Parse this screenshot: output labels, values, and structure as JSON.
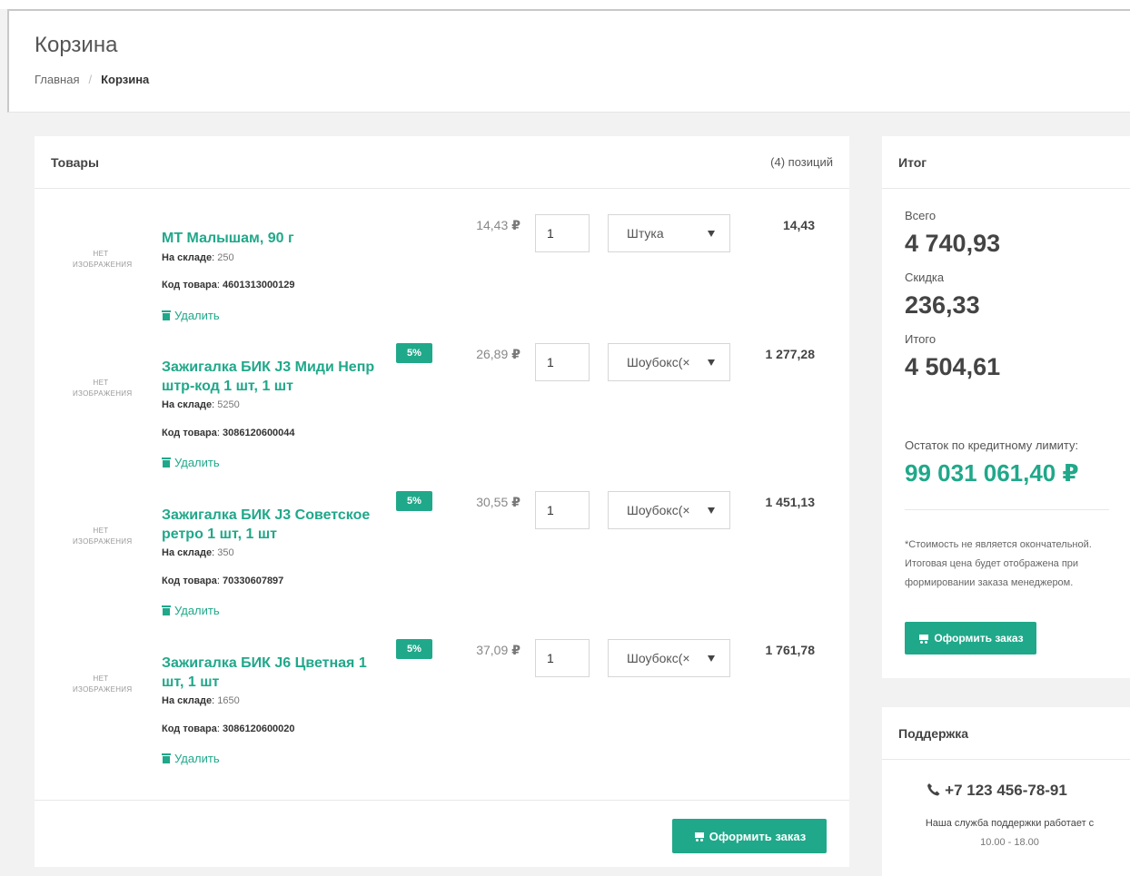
{
  "page": {
    "title": "Корзина"
  },
  "breadcrumb": {
    "home": "Главная",
    "separator": "/",
    "current": "Корзина"
  },
  "cart": {
    "header": "Товары",
    "count_label": "(4) позиций",
    "no_image": [
      "НЕТ",
      "ИЗОБРАЖЕНИЯ"
    ],
    "stock_label": "На складе",
    "code_label": "Код товара",
    "delete_label": "Удалить",
    "currency": "₽",
    "items": [
      {
        "name": "МТ Малышам, 90 г",
        "stock": "250",
        "code": "4601313000129",
        "discount": "",
        "price": "14,43",
        "qty": "1",
        "unit": "Штука",
        "total": "14,43"
      },
      {
        "name": "Зажигалка БИК J3 Миди Непр штр-код 1 шт, 1 шт",
        "stock": "5250",
        "code": "3086120600044",
        "discount": "5%",
        "price": "26,89",
        "qty": "1",
        "unit": "Шоубокс(×",
        "total": "1 277,28"
      },
      {
        "name": "Зажигалка БИК J3 Советское ретро 1 шт, 1 шт",
        "stock": "350",
        "code": "70330607897",
        "discount": "5%",
        "price": "30,55",
        "qty": "1",
        "unit": "Шоубокс(×",
        "total": "1 451,13"
      },
      {
        "name": "Зажигалка БИК J6 Цветная 1 шт, 1 шт",
        "stock": "1650",
        "code": "3086120600020",
        "discount": "5%",
        "price": "37,09",
        "qty": "1",
        "unit": "Шоубокс(×",
        "total": "1 761,78"
      }
    ],
    "checkout_label": "Оформить заказ"
  },
  "summary": {
    "header": "Итог",
    "total_label": "Всего",
    "total_value": "4 740,93",
    "discount_label": "Скидка",
    "discount_value": "236,33",
    "final_label": "Итого",
    "final_value": "4 504,61",
    "credit_label": "Остаток по кредитному лимиту:",
    "credit_value": "99 031 061,40 ₽",
    "note": "*Стоимость не является окончательной. Итоговая цена будет отображена при формировании заказа менеджером.",
    "checkout_label": "Оформить заказ"
  },
  "support": {
    "header": "Поддержка",
    "phone": "+7 123 456-78-91",
    "text": "Наша служба поддержки работает с",
    "hours": "10.00 - 18.00"
  },
  "colors": {
    "accent": "#20a88a",
    "background": "#f2f2f2"
  },
  "icons": {
    "delete": "trash-icon",
    "checkout": "cart-icon",
    "phone": "phone-icon",
    "select": "chevron-down-icon"
  }
}
